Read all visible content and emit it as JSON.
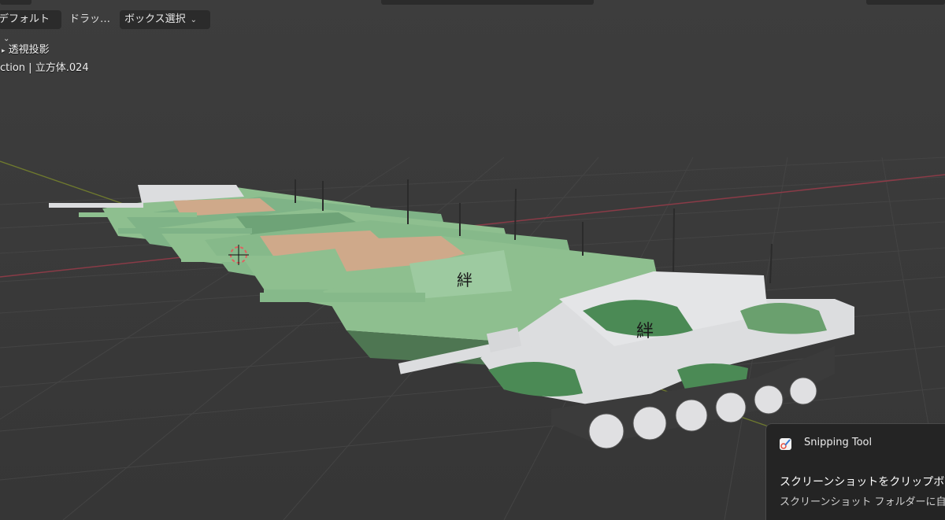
{
  "header": {
    "shading_mode": "デフォルト",
    "drag_label": "ドラッ…",
    "select_mode": "ボックス選択"
  },
  "viewport_overlay": {
    "projection": "透視投影",
    "collection_object": "ction | 立方体.024"
  },
  "scene": {
    "turret_text": "絆",
    "background_color": "#3a3a3a",
    "grid_color": "#444444",
    "x_axis_color": "#8a3b47",
    "y_axis_color": "#6f7a2e",
    "winter_camo": [
      "#dcdddf",
      "#4b8a55",
      "#6aa06e"
    ],
    "green_camo": [
      "#8ebf8f",
      "#6ea377",
      "#cfa98a"
    ]
  },
  "notification": {
    "app_name": "Snipping Tool",
    "title": "スクリーンショットをクリップボード",
    "body": "スクリーンショット フォルダーに自"
  }
}
